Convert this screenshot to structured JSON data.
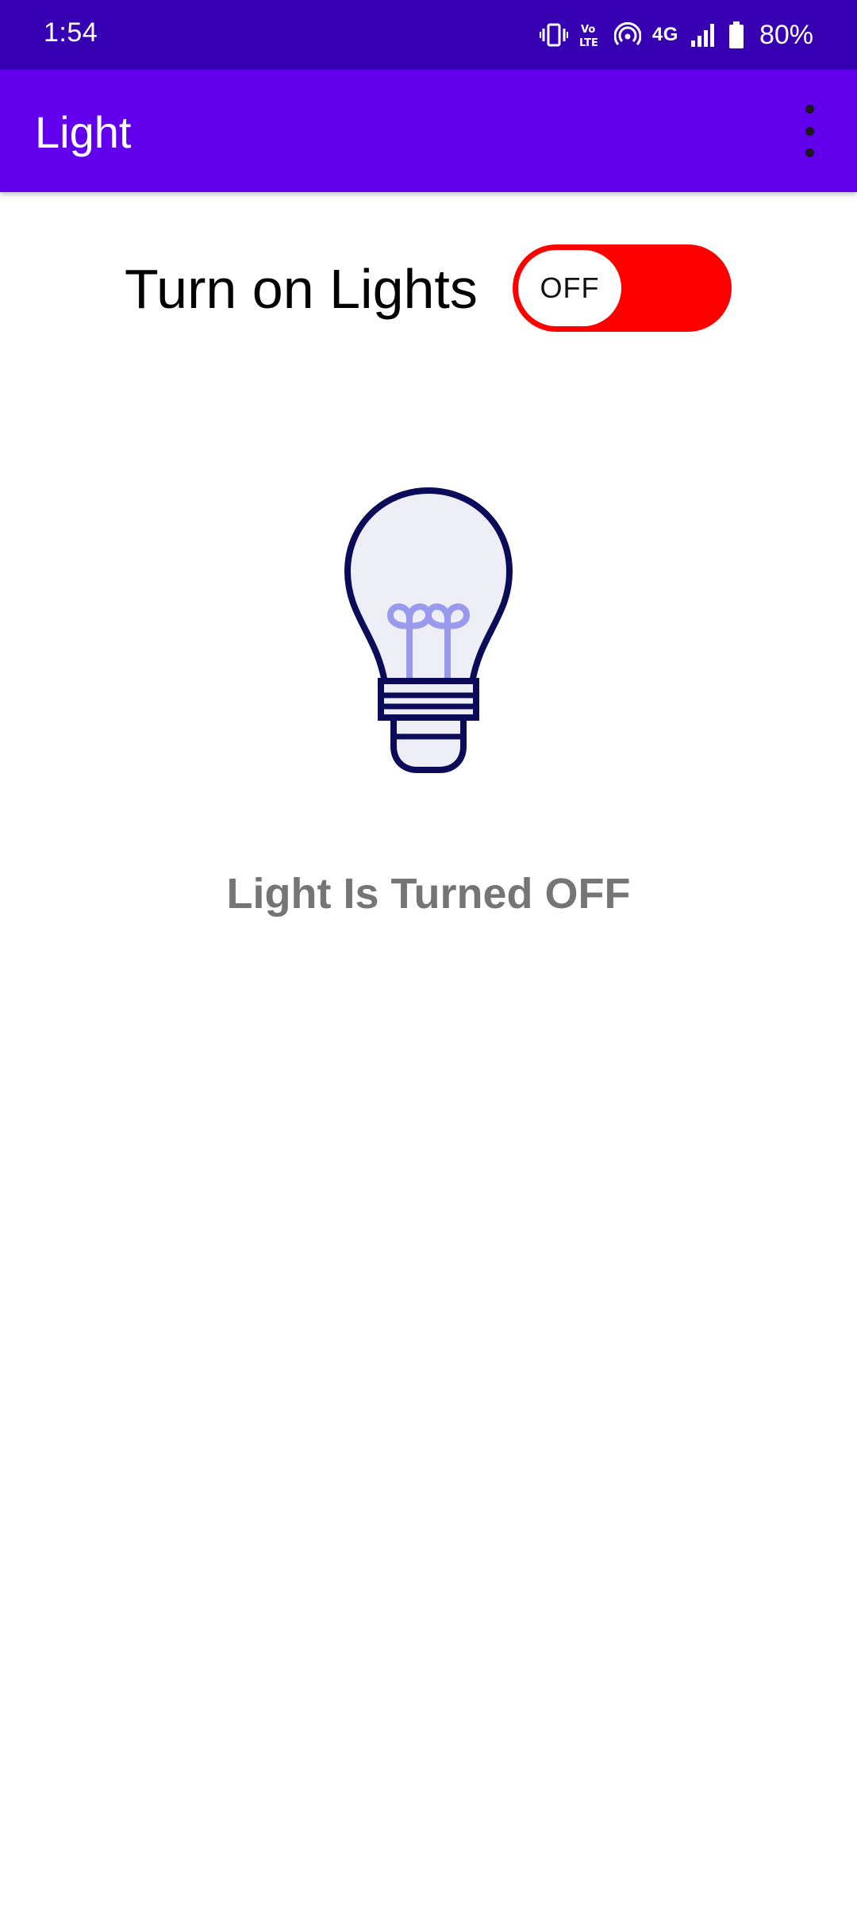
{
  "status_bar": {
    "time": "1:54",
    "network": "4G",
    "battery_percent": "80%",
    "icons": [
      "vibrate-icon",
      "volte-icon",
      "hotspot-icon",
      "4g-icon",
      "signal-icon",
      "battery-icon"
    ]
  },
  "app_bar": {
    "title": "Light",
    "overflow_icon": "more-vert-icon"
  },
  "main": {
    "switch_label": "Turn on Lights",
    "toggle": {
      "state_label": "OFF",
      "is_on": false
    },
    "bulb_icon": "lightbulb-icon",
    "status_text": "Light Is Turned OFF"
  },
  "colors": {
    "status_bar": "#3700b3",
    "app_bar": "#6200ee",
    "toggle_track_off": "#ff0000",
    "bulb_outline": "#0b0b5a",
    "bulb_fill": "#eeeef6",
    "bulb_filament": "#9999ee",
    "status_text": "#757575"
  }
}
